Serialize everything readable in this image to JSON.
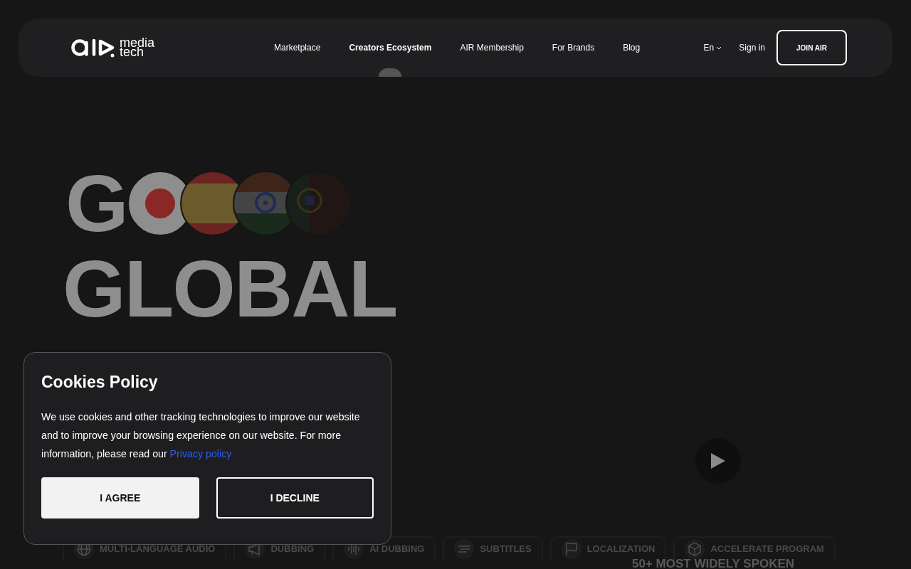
{
  "nav": {
    "logo": {
      "lines": [
        "media",
        "tech"
      ]
    },
    "items": [
      {
        "label": "Marketplace",
        "selected": false
      },
      {
        "label": "Creators Ecosystem",
        "selected": true
      },
      {
        "label": "AIR Membership",
        "selected": false
      },
      {
        "label": "For Brands",
        "selected": false
      },
      {
        "label": "Blog",
        "selected": false
      }
    ],
    "language": "En",
    "sign_in": "Sign in",
    "join": "JOIN AIR"
  },
  "hero": {
    "heading_line_1": "G",
    "flags": [
      {
        "kind": "japan"
      },
      {
        "kind": "spain"
      },
      {
        "kind": "india"
      },
      {
        "kind": "portugal"
      }
    ],
    "heading_line_2": "GLOBAL"
  },
  "features": [
    {
      "label": "MULTI-LANGUAGE AUDIO",
      "kind": "globe"
    },
    {
      "label": "DUBBING",
      "kind": "megaphone"
    },
    {
      "label": "AI DUBBING",
      "kind": "wave"
    },
    {
      "label": "SUBTITLES",
      "kind": "lines"
    },
    {
      "label": "LOCALIZATION",
      "kind": "flag"
    },
    {
      "label": "ACCELERATE PROGRAM",
      "kind": "cube"
    }
  ],
  "section_caption": "50+ MOST WIDELY SPOKEN",
  "cookie": {
    "title": "Cookies Policy",
    "text": "We use cookies and other tracking technologies to improve our website and to improve your browsing experience on our website. For more information, please read our ",
    "link": "Privacy policy",
    "buttons": [
      {
        "label": "I AGREE",
        "kind": "primary"
      },
      {
        "label": "I DECLINE",
        "kind": "outline"
      }
    ]
  }
}
